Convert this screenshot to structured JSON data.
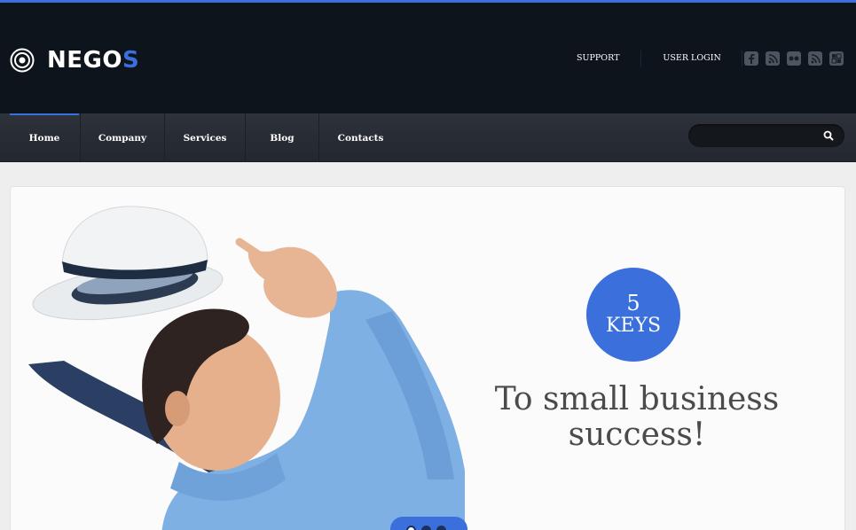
{
  "brand": {
    "name_main": "NEGO",
    "name_accent": "S",
    "accent_color": "#3a6fdc"
  },
  "header": {
    "links": [
      {
        "label": "SUPPORT"
      },
      {
        "label": "USER LOGIN"
      }
    ],
    "social_icons": [
      "facebook-icon",
      "rss-icon",
      "flickr-icon",
      "rss-alt-icon",
      "delicious-icon"
    ]
  },
  "nav": {
    "items": [
      {
        "label": "Home",
        "active": true
      },
      {
        "label": "Company"
      },
      {
        "label": "Services"
      },
      {
        "label": "Blog"
      },
      {
        "label": "Contacts"
      }
    ]
  },
  "search": {
    "placeholder": "",
    "value": ""
  },
  "slider": {
    "badge_number": "5",
    "badge_word": "KEYS",
    "headline_line1": "To small business",
    "headline_line2": "success!",
    "current_slide": 1,
    "slide_count": 3
  }
}
